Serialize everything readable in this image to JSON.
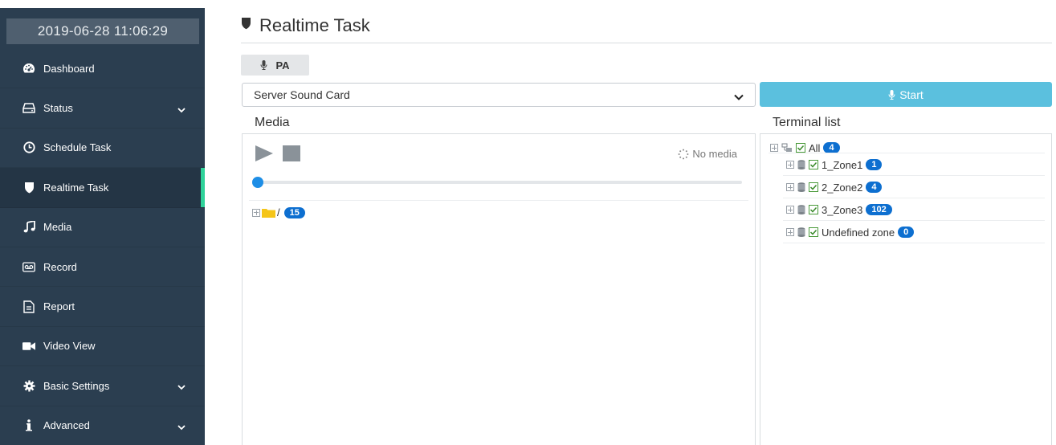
{
  "sidebar": {
    "datetime": "2019-06-28 11:06:29",
    "items": [
      {
        "label": "Dashboard",
        "icon": "dashboard-icon"
      },
      {
        "label": "Status",
        "icon": "hdd-icon",
        "has_submenu": true
      },
      {
        "label": "Schedule Task",
        "icon": "clock-icon"
      },
      {
        "label": "Realtime Task",
        "icon": "shield-icon",
        "active": true
      },
      {
        "label": "Media",
        "icon": "music-icon"
      },
      {
        "label": "Record",
        "icon": "voicemail-icon"
      },
      {
        "label": "Report",
        "icon": "file-text-icon"
      },
      {
        "label": "Video View",
        "icon": "video-camera-icon"
      },
      {
        "label": "Basic Settings",
        "icon": "gear-icon",
        "has_submenu": true
      },
      {
        "label": "Advanced",
        "icon": "info-icon",
        "has_submenu": true
      }
    ]
  },
  "header": {
    "title": "Realtime Task"
  },
  "tabs": {
    "pa_label": "PA"
  },
  "source_select": {
    "value": "Server Sound Card"
  },
  "start_button": {
    "label": "Start"
  },
  "media": {
    "section_label": "Media",
    "status_text": "No media",
    "progress": 0,
    "folder": {
      "name": "/",
      "count": "15"
    }
  },
  "terminal": {
    "section_label": "Terminal list",
    "root": {
      "label": "All",
      "count": "4"
    },
    "zones": [
      {
        "label": "1_Zone1",
        "count": "1"
      },
      {
        "label": "2_Zone2",
        "count": "4"
      },
      {
        "label": "3_Zone3",
        "count": "102"
      },
      {
        "label": "Undefined zone",
        "count": "0"
      }
    ]
  },
  "colors": {
    "sidebar_bg": "#2b3e50",
    "active_indicator": "#2fd29a",
    "start_button": "#5bc0de",
    "badge": "#0d6fd0",
    "progress_knob": "#1e8ee6",
    "folder": "#f5c518"
  }
}
